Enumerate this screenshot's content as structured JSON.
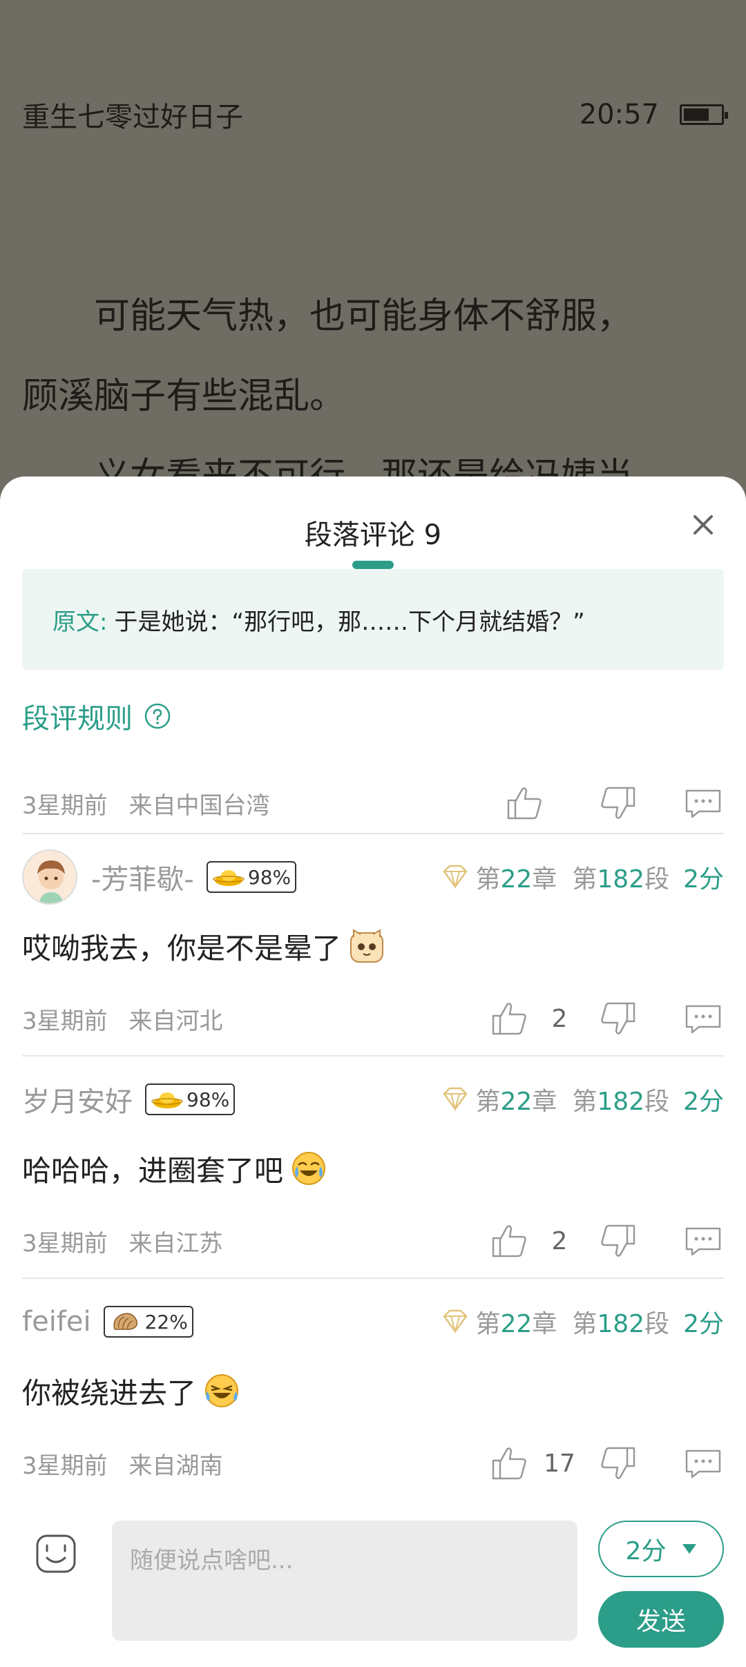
{
  "reader": {
    "book_title": "重生七零过好日子",
    "time": "20:57",
    "paragraphs": [
      "可能天气热，也可能身体不舒服，",
      "顾溪脑子有些混乱。",
      "义女看来不可行，那还是给冯姨当"
    ]
  },
  "sheet": {
    "title": "段落评论 9",
    "quote_label": "原文:",
    "quote_text": "于是她说：“那行吧，那……下个月就结婚？”",
    "rules_label": "段评规则",
    "top_meta": {
      "time": "3星期前",
      "location": "来自中国台湾"
    }
  },
  "comments": [
    {
      "username": "-芳菲歇-",
      "badge": "98%",
      "chapter_prefix": "第",
      "chapter_num": "22",
      "chapter_suffix": "章",
      "para_prefix": "第",
      "para_num": "182",
      "para_suffix": "段",
      "score": "2分",
      "text": "哎呦我去，你是不是晕了",
      "time": "3星期前",
      "location": "来自河北",
      "likes": "2"
    },
    {
      "username": "岁月安好",
      "badge": "98%",
      "chapter_prefix": "第",
      "chapter_num": "22",
      "chapter_suffix": "章",
      "para_prefix": "第",
      "para_num": "182",
      "para_suffix": "段",
      "score": "2分",
      "text": "哈哈哈，进圈套了吧",
      "time": "3星期前",
      "location": "来自江苏",
      "likes": "2"
    },
    {
      "username": "feifei",
      "badge": "22%",
      "chapter_prefix": "第",
      "chapter_num": "22",
      "chapter_suffix": "章",
      "para_prefix": "第",
      "para_num": "182",
      "para_suffix": "段",
      "score": "2分",
      "text": "你被绕进去了",
      "time": "3星期前",
      "location": "来自湖南",
      "likes": "17"
    }
  ],
  "input": {
    "placeholder": "随便说点啥吧...",
    "score_value": "2分",
    "send_label": "发送"
  },
  "colors": {
    "accent": "#2b9d88",
    "quote_bg": "#eef6f3",
    "overlay": "#6f6d63"
  }
}
